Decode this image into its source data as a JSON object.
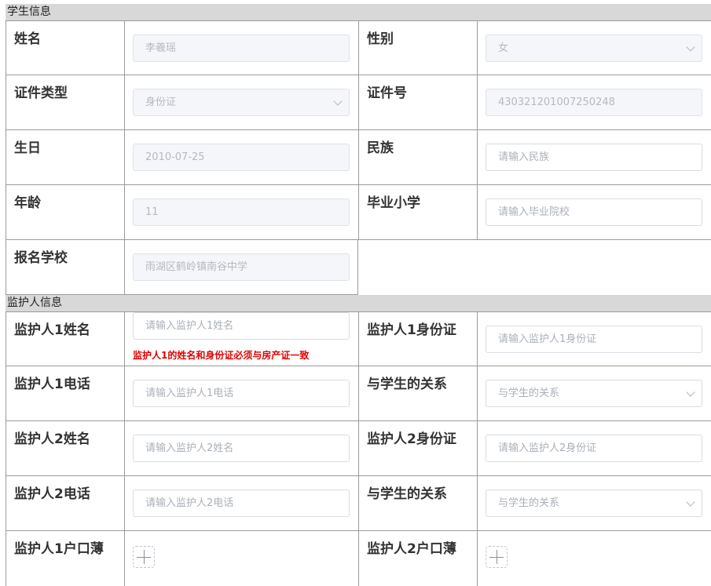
{
  "sections": {
    "student": "学生信息",
    "guardian": "监护人信息"
  },
  "student": {
    "name": {
      "label": "姓名",
      "value": "李羲瑶"
    },
    "gender": {
      "label": "性别",
      "value": "女"
    },
    "id_type": {
      "label": "证件类型",
      "value": "身份证"
    },
    "id_number": {
      "label": "证件号",
      "value": "430321201007250248"
    },
    "birthday": {
      "label": "生日",
      "value": "2010-07-25"
    },
    "ethnicity": {
      "label": "民族",
      "placeholder": "请输入民族"
    },
    "age": {
      "label": "年龄",
      "value": "11"
    },
    "primary_school": {
      "label": "毕业小学",
      "placeholder": "请输入毕业院校"
    },
    "apply_school": {
      "label": "报名学校",
      "value": "雨湖区鹤岭镇南谷中学"
    }
  },
  "guardian": {
    "g1_name": {
      "label": "监护人1姓名",
      "placeholder": "请输入监护人1姓名",
      "warning": "监护人1的姓名和身份证必须与房产证一致"
    },
    "g1_id": {
      "label": "监护人1身份证",
      "placeholder": "请输入监护人1身份证"
    },
    "g1_phone": {
      "label": "监护人1电话",
      "placeholder": "请输入监护人1电话"
    },
    "g1_relation": {
      "label": "与学生的关系",
      "placeholder": "与学生的关系"
    },
    "g2_name": {
      "label": "监护人2姓名",
      "placeholder": "请输入监护人2姓名"
    },
    "g2_id": {
      "label": "监护人2身份证",
      "placeholder": "请输入监护人2身份证"
    },
    "g2_phone": {
      "label": "监护人2电话",
      "placeholder": "请输入监护人2电话"
    },
    "g2_relation": {
      "label": "与学生的关系",
      "placeholder": "与学生的关系"
    },
    "g1_hukou": {
      "label": "监护人1户口薄"
    },
    "g2_hukou": {
      "label": "监护人2户口薄"
    }
  }
}
